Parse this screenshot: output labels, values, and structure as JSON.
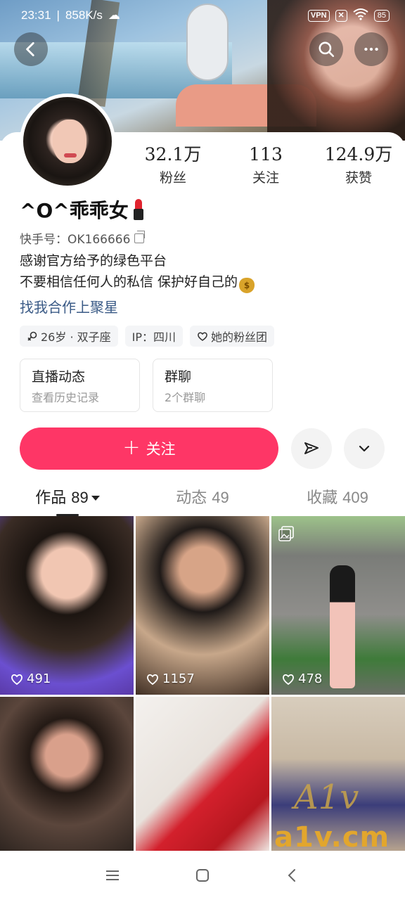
{
  "status_bar": {
    "time": "23:31",
    "speed": "858K/s",
    "vpn": "VPN",
    "battery": "85"
  },
  "profile": {
    "stats": [
      {
        "value": "32.1万",
        "label": "粉丝"
      },
      {
        "value": "113",
        "label": "关注"
      },
      {
        "value": "124.9万",
        "label": "获赞"
      }
    ],
    "name": "^O^乖乖女",
    "id_line": "快手号：OK166666",
    "bio_line1": "感谢官方给予的绿色平台",
    "bio_line2": "不要相信任何人的私信 保护好自己的",
    "biz_link": "找我合作上聚星",
    "tags": [
      "26岁 · 双子座",
      "IP：四川",
      "她的粉丝团"
    ]
  },
  "quick_cards": [
    {
      "title": "直播动态",
      "subtitle": "查看历史记录"
    },
    {
      "title": "群聊",
      "subtitle": "2个群聊"
    }
  ],
  "follow_button": "关注",
  "tabs": [
    {
      "label": "作品",
      "count": "89"
    },
    {
      "label": "动态",
      "count": "49"
    },
    {
      "label": "收藏",
      "count": "409"
    }
  ],
  "posts": [
    {
      "likes": "491"
    },
    {
      "likes": "1157"
    },
    {
      "likes": "478"
    }
  ],
  "watermark": {
    "monogram": "A1v",
    "text": "a1v.cm"
  },
  "colors": {
    "accent": "#fe3666",
    "link": "#3a5a86"
  }
}
